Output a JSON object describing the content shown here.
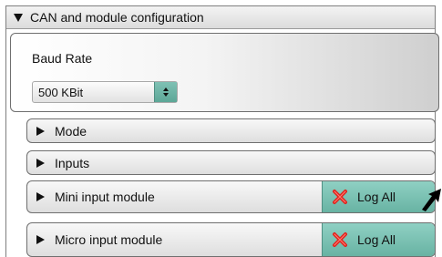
{
  "panel": {
    "title": "CAN and module configuration",
    "expanded": true
  },
  "baud": {
    "label": "Baud Rate",
    "selected": "500 KBit"
  },
  "sections": {
    "mode": {
      "label": "Mode",
      "expanded": false
    },
    "inputs": {
      "label": "Inputs",
      "expanded": false
    },
    "mini": {
      "label": "Mini input module",
      "expanded": false,
      "log_label": "Log All"
    },
    "micro": {
      "label": "Micro input module",
      "expanded": false,
      "log_label": "Log All"
    }
  },
  "colors": {
    "accent": "#7cc2b3",
    "log_x": "#e0201b"
  },
  "icons": {
    "collapse": "triangle-down-icon",
    "expand": "triangle-right-icon",
    "log": "x-icon",
    "pointer": "arrow-pointer-icon"
  }
}
